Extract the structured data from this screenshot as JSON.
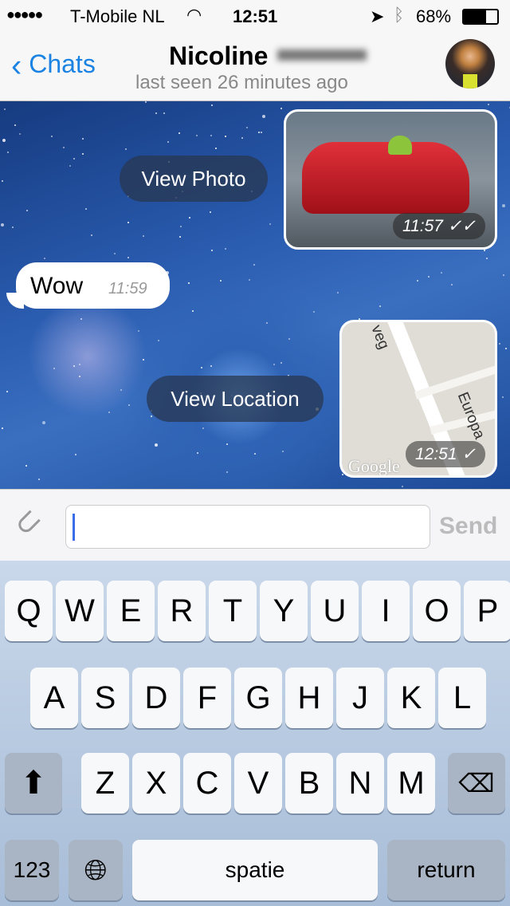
{
  "status": {
    "carrier": "T-Mobile NL",
    "time": "12:51",
    "battery": "68%",
    "signal_dots": 5,
    "icons": [
      "signal-icon",
      "wifi-icon",
      "location-icon",
      "bluetooth-icon",
      "battery-icon"
    ]
  },
  "nav": {
    "back_label": "Chats",
    "title": "Nicoline",
    "subtitle": "last seen 26 minutes ago",
    "accent": "#1a82e2"
  },
  "messages": [
    {
      "type": "photo",
      "direction": "out",
      "time": "11:57",
      "status": "read",
      "action": "View Photo"
    },
    {
      "type": "text",
      "direction": "in",
      "text": "Wow",
      "time": "11:59"
    },
    {
      "type": "location",
      "direction": "out",
      "time": "12:51",
      "status": "sent",
      "action": "View Location",
      "map_labels": [
        "veg",
        "Europa"
      ],
      "attribution": "Google"
    }
  ],
  "composer": {
    "value": "",
    "send_label": "Send"
  },
  "keyboard": {
    "rows": [
      [
        "Q",
        "W",
        "E",
        "R",
        "T",
        "Y",
        "U",
        "I",
        "O",
        "P"
      ],
      [
        "A",
        "S",
        "D",
        "F",
        "G",
        "H",
        "J",
        "K",
        "L"
      ],
      [
        "Z",
        "X",
        "C",
        "V",
        "B",
        "N",
        "M"
      ]
    ],
    "numbers_label": "123",
    "space_label": "spatie",
    "return_label": "return"
  }
}
